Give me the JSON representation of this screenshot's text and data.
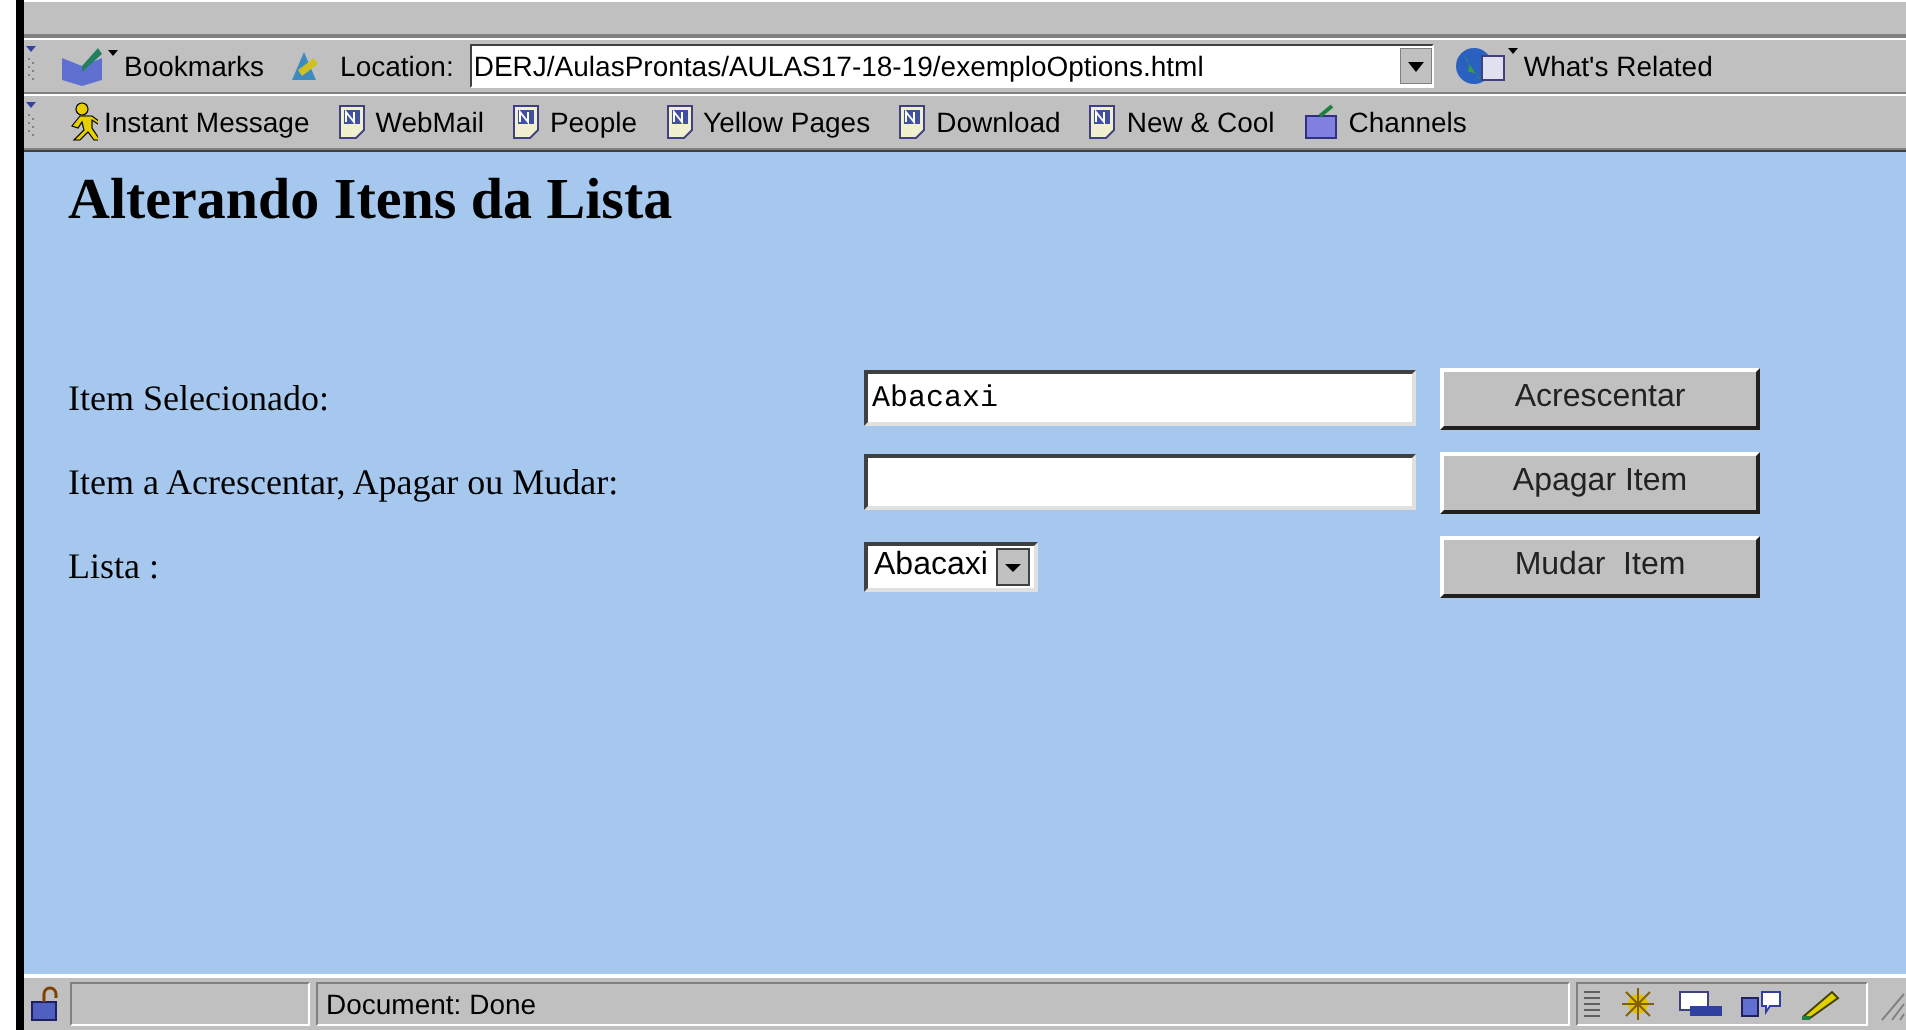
{
  "toolbar": {
    "bookmarks": "Bookmarks",
    "location_label": "Location:",
    "location_value": "DERJ/AulasProntas/AULAS17-18-19/exemploOptions.html",
    "whats_related": "What's Related"
  },
  "personal_toolbar": [
    {
      "label": "Instant Message",
      "kind": "runner"
    },
    {
      "label": "WebMail",
      "kind": "page"
    },
    {
      "label": "People",
      "kind": "page"
    },
    {
      "label": "Yellow Pages",
      "kind": "page"
    },
    {
      "label": "Download",
      "kind": "page"
    },
    {
      "label": "New & Cool",
      "kind": "page"
    },
    {
      "label": "Channels",
      "kind": "channels"
    }
  ],
  "page": {
    "heading": "Alterando Itens da Lista",
    "rows": [
      {
        "label": "Item Selecionado:",
        "kind": "text",
        "value": "Abacaxi",
        "button": "Acrescentar"
      },
      {
        "label": "Item a Acrescentar, Apagar ou Mudar:",
        "kind": "text",
        "value": "",
        "button": "Apagar Item"
      },
      {
        "label": "Lista :",
        "kind": "select",
        "value": "Abacaxi",
        "button": "Mudar  Item"
      }
    ]
  },
  "status_bar": {
    "text": "Document: Done"
  }
}
